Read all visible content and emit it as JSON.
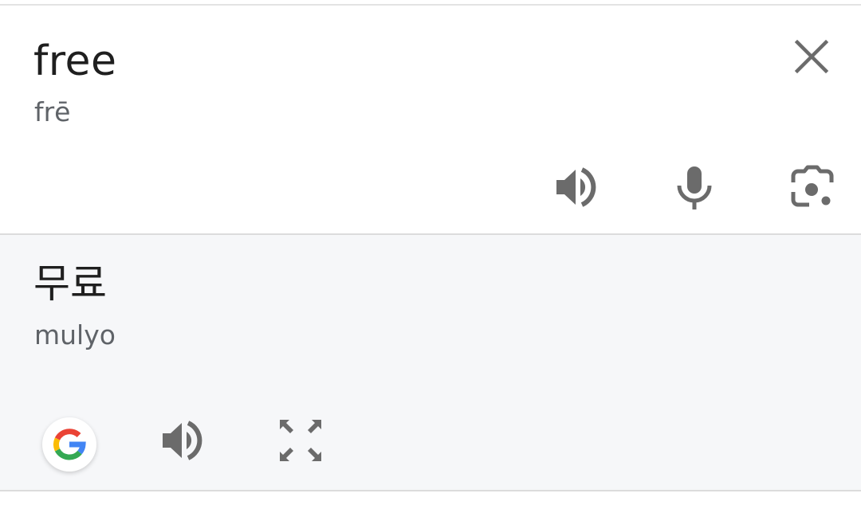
{
  "source": {
    "text": "free",
    "transliteration": "frē"
  },
  "result": {
    "text": "무료",
    "transliteration": "mulyo"
  },
  "icons": {
    "close": "close-icon",
    "source_speaker": "volume-up-icon",
    "microphone": "mic-icon",
    "camera": "google-lens-icon",
    "google": "google-logo-icon",
    "result_speaker": "volume-up-icon",
    "fullscreen": "fullscreen-icon"
  },
  "colors": {
    "icon_gray": "#6b6b6b",
    "text_primary": "#1f1f1f",
    "text_secondary": "#5f6368",
    "result_background": "#f6f7f9",
    "google_blue": "#4285F4",
    "google_red": "#EA4335",
    "google_yellow": "#FBBC05",
    "google_green": "#34A853"
  }
}
